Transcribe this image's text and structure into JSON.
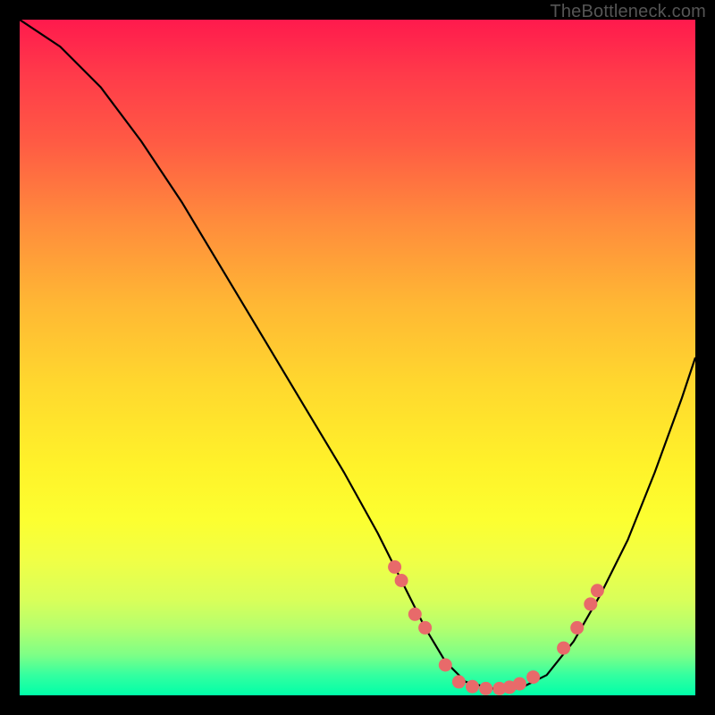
{
  "watermark": "TheBottleneck.com",
  "chart_data": {
    "type": "line",
    "title": "",
    "xlabel": "",
    "ylabel": "",
    "xlim": [
      0,
      100
    ],
    "ylim": [
      0,
      100
    ],
    "series": [
      {
        "name": "curve",
        "x": [
          0,
          6,
          12,
          18,
          24,
          30,
          36,
          42,
          48,
          53,
          57,
          60,
          63,
          66,
          70,
          74,
          78,
          82,
          86,
          90,
          94,
          98,
          100
        ],
        "y": [
          100,
          96,
          90,
          82,
          73,
          63,
          53,
          43,
          33,
          24,
          16,
          10,
          5,
          2,
          1,
          1,
          3,
          8,
          15,
          23,
          33,
          44,
          50
        ]
      }
    ],
    "markers": {
      "name": "dots",
      "color": "#e86a6a",
      "points": [
        {
          "x": 55.5,
          "y": 19
        },
        {
          "x": 56.5,
          "y": 17
        },
        {
          "x": 58.5,
          "y": 12
        },
        {
          "x": 60.0,
          "y": 10
        },
        {
          "x": 63.0,
          "y": 4.5
        },
        {
          "x": 65.0,
          "y": 2
        },
        {
          "x": 67.0,
          "y": 1.3
        },
        {
          "x": 69.0,
          "y": 1
        },
        {
          "x": 71.0,
          "y": 1
        },
        {
          "x": 72.5,
          "y": 1.2
        },
        {
          "x": 74.0,
          "y": 1.7
        },
        {
          "x": 76.0,
          "y": 2.7
        },
        {
          "x": 80.5,
          "y": 7
        },
        {
          "x": 82.5,
          "y": 10
        },
        {
          "x": 84.5,
          "y": 13.5
        },
        {
          "x": 85.5,
          "y": 15.5
        }
      ]
    }
  }
}
